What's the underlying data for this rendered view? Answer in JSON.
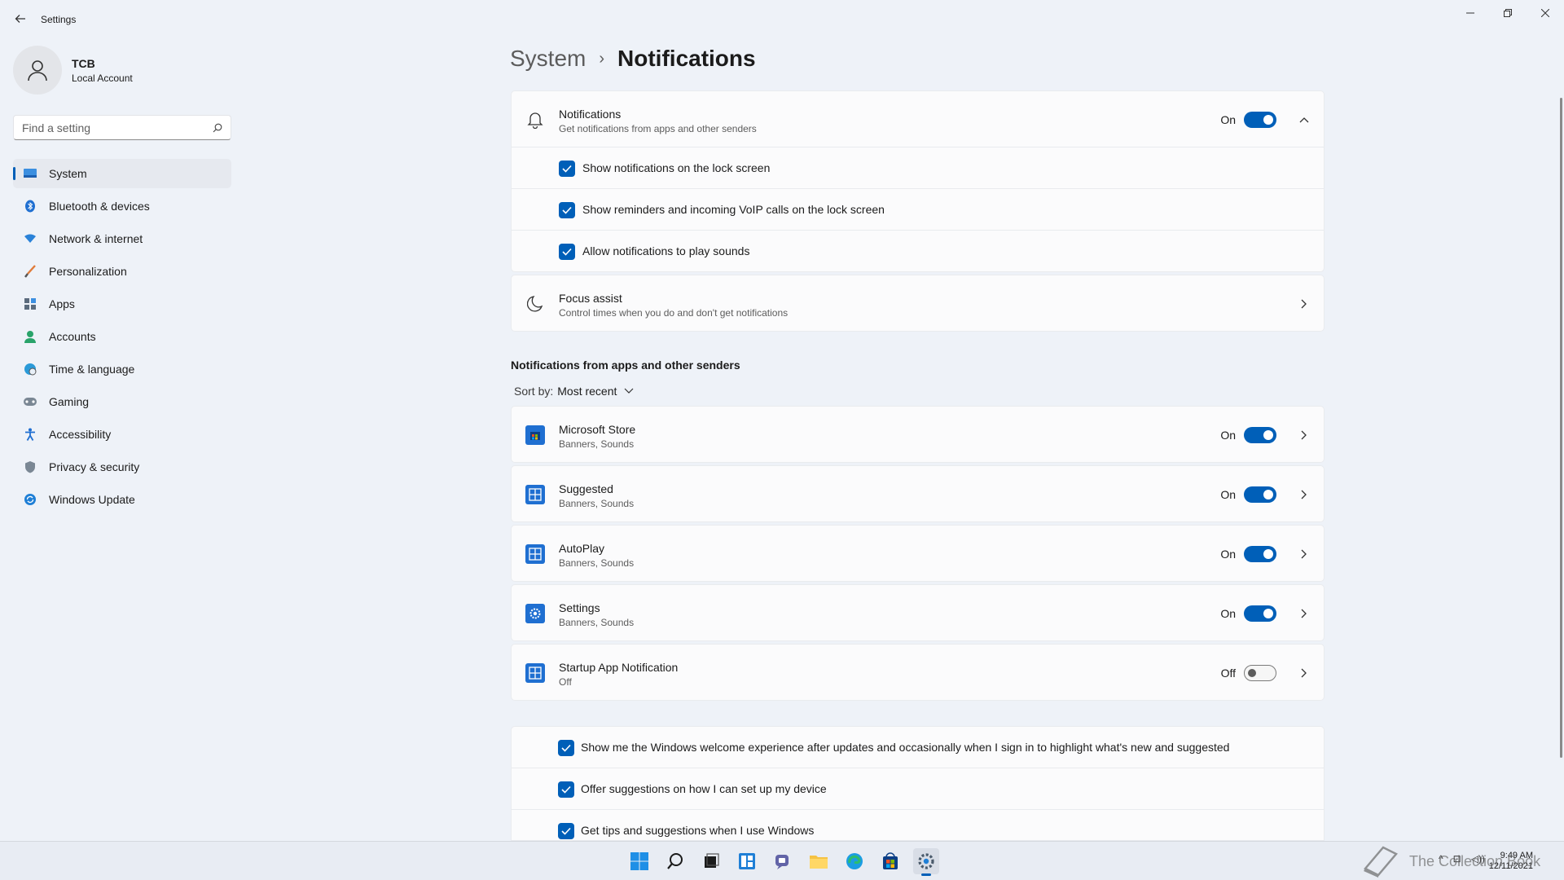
{
  "window": {
    "title": "Settings",
    "back_icon": "arrow-left-icon",
    "minimize_icon": "minimize-icon",
    "restore_icon": "restore-icon",
    "close_icon": "close-icon"
  },
  "profile": {
    "name": "TCB",
    "account_type": "Local Account"
  },
  "search": {
    "placeholder": "Find a setting"
  },
  "sidebar": {
    "items": [
      {
        "label": "System",
        "icon": "monitor-icon",
        "active": true
      },
      {
        "label": "Bluetooth & devices",
        "icon": "bluetooth-icon"
      },
      {
        "label": "Network & internet",
        "icon": "wifi-icon"
      },
      {
        "label": "Personalization",
        "icon": "brush-icon"
      },
      {
        "label": "Apps",
        "icon": "apps-icon"
      },
      {
        "label": "Accounts",
        "icon": "person-icon"
      },
      {
        "label": "Time & language",
        "icon": "globe-clock-icon"
      },
      {
        "label": "Gaming",
        "icon": "gamepad-icon"
      },
      {
        "label": "Accessibility",
        "icon": "accessibility-icon"
      },
      {
        "label": "Privacy & security",
        "icon": "shield-icon"
      },
      {
        "label": "Windows Update",
        "icon": "update-icon"
      }
    ]
  },
  "breadcrumb": {
    "parent": "System",
    "separator": "›",
    "current": "Notifications"
  },
  "notifications": {
    "title": "Notifications",
    "subtitle": "Get notifications from apps and other senders",
    "state": "On",
    "options": [
      "Show notifications on the lock screen",
      "Show reminders and incoming VoIP calls on the lock screen",
      "Allow notifications to play sounds"
    ]
  },
  "focus_assist": {
    "title": "Focus assist",
    "subtitle": "Control times when you do and don't get notifications"
  },
  "apps_section": {
    "heading": "Notifications from apps and other senders",
    "sort_label": "Sort by:",
    "sort_value": "Most recent",
    "apps": [
      {
        "name": "Microsoft Store",
        "detail": "Banners, Sounds",
        "state": "On"
      },
      {
        "name": "Suggested",
        "detail": "Banners, Sounds",
        "state": "On"
      },
      {
        "name": "AutoPlay",
        "detail": "Banners, Sounds",
        "state": "On"
      },
      {
        "name": "Settings",
        "detail": "Banners, Sounds",
        "state": "On"
      },
      {
        "name": "Startup App Notification",
        "detail": "Off",
        "state": "Off"
      }
    ]
  },
  "extra_options": [
    "Show me the Windows welcome experience after updates and occasionally when I sign in to highlight what's new and suggested",
    "Offer suggestions on how I can set up my device",
    "Get tips and suggestions when I use Windows"
  ],
  "taskbar": {
    "time": "9:49 AM",
    "date": "12/11/2021",
    "watermark": "The Collection Book",
    "accent": "#005fb8"
  }
}
